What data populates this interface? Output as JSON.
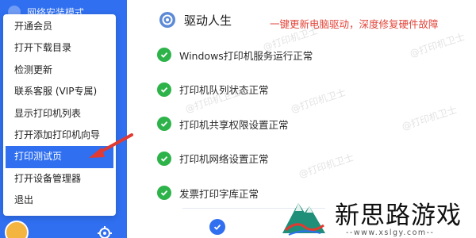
{
  "sidebar": {
    "top_label": "网络安装模式"
  },
  "menu": {
    "items": [
      {
        "label": "开通会员"
      },
      {
        "label": "打开下载目录"
      },
      {
        "label": "检测更新"
      },
      {
        "label": "联系客服 (VIP专属)"
      },
      {
        "label": "显示打印机列表"
      },
      {
        "label": "打开添加打印机向导"
      },
      {
        "label": "打印测试页"
      },
      {
        "label": "打开设备管理器"
      },
      {
        "label": "退出"
      }
    ],
    "active_index": 6
  },
  "header": {
    "title": "驱动人生",
    "tagline": "一键更新电脑驱动，深度修复硬件故障"
  },
  "status_items": [
    {
      "text": "Windows打印机服务运行正常"
    },
    {
      "text": "打印机队列状态正常"
    },
    {
      "text": "打印机共享权限设置正常"
    },
    {
      "text": "打印机网络设置正常"
    },
    {
      "text": "发票打印字库正常"
    }
  ],
  "watermark": {
    "text": "@打印机卫士"
  },
  "site": {
    "name": "新思路游戏",
    "url": "--www.xslgy.com--"
  },
  "colors": {
    "sidebar_blue": "#2f6ff0",
    "check_green": "#2eb34a",
    "tagline_red": "#e2453a",
    "arrow_red": "#e23a30"
  }
}
